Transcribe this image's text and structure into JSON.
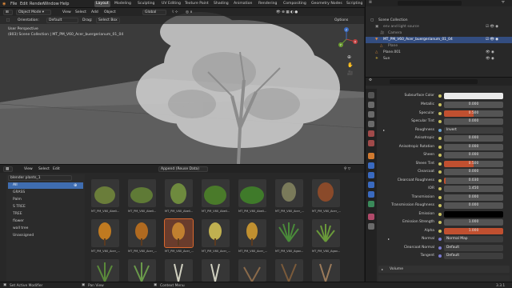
{
  "topbar": {
    "menus": [
      "File",
      "Edit",
      "Render",
      "Window",
      "Help"
    ],
    "workspaces": [
      "Layout",
      "Modeling",
      "Sculpting",
      "UV Editing",
      "Texture Paint",
      "Shading",
      "Animation",
      "Rendering",
      "Compositing",
      "Geometry Nodes",
      "Scripting"
    ],
    "active_workspace": "Layout",
    "scene": "Scene",
    "view_layer": "ViewLayer"
  },
  "viewport": {
    "mode": "Object Mode",
    "menus": [
      "View",
      "Select",
      "Add",
      "Object"
    ],
    "transform": "Global",
    "orientation_label": "Orientation:",
    "orientation_value": "Default",
    "drag_label": "Drag:",
    "drag_value": "Select Box",
    "options": "Options",
    "overlay_line1": "User Perspective",
    "overlay_line2": "(803) Scene Collection | MT_PM_V60_Acer_buergerianum_01_04",
    "gizmo_axes": [
      "X",
      "Y",
      "Z"
    ]
  },
  "asset_browser": {
    "menus": [
      "View",
      "Select",
      "Edit"
    ],
    "library": "blender plants_1",
    "import_type": "Append (Reuse Data)",
    "categories": [
      "All",
      "GRASS",
      "Palm",
      "S TREE",
      "TREE",
      "flower",
      "wall tree",
      "Unassigned"
    ],
    "active_category": "All",
    "tiles_row1": [
      "MT_PM_V60_Abeli...",
      "MT_PM_V60_Abeli...",
      "MT_PM_V60_Abeli...",
      "MT_PM_V60_Abeli...",
      "MT_PM_V60_Abeli...",
      "MT_PM_V60_Acer_...",
      "MT_PM_V60_Acer_..."
    ],
    "tiles_row2": [
      "MT_PM_V60_Acer_...",
      "MT_PM_V60_Acer_...",
      "MT_PM_V60_Acer_...",
      "MT_PM_V60_Acer_...",
      "MT_PM_V60_Acer_...",
      "MT_PM_V60_Agav...",
      "MT_PM_V60_Agav..."
    ]
  },
  "outliner": {
    "title": "Scene Collection",
    "rows": [
      "Scene Collection",
      "env and light source",
      "Camera",
      "MT_PM_V60_Acer_buergerianum_01_04",
      "Plane",
      "Plane.001",
      "Sun"
    ],
    "selected_row": "MT_PM_V60_Acer_buergerianum_01_04"
  },
  "properties": {
    "rows": [
      {
        "label": "Subsurface Color",
        "value": ""
      },
      {
        "label": "Metallic",
        "value": "0.000"
      },
      {
        "label": "Specular",
        "value": "0.500"
      },
      {
        "label": "Specular Tint",
        "value": "0.000"
      },
      {
        "label": "Roughness",
        "value": "Invert"
      },
      {
        "label": "Anisotropic",
        "value": "0.000"
      },
      {
        "label": "Anisotropic Rotation",
        "value": "0.000"
      },
      {
        "label": "Sheen",
        "value": "0.000"
      },
      {
        "label": "Sheen Tint",
        "value": "0.500"
      },
      {
        "label": "Clearcoat",
        "value": "0.000"
      },
      {
        "label": "Clearcoat Roughness",
        "value": "0.030"
      },
      {
        "label": "IOR",
        "value": "1.450"
      },
      {
        "label": "Transmission",
        "value": "0.000"
      },
      {
        "label": "Transmission Roughness",
        "value": "0.000"
      },
      {
        "label": "Emission",
        "value": ""
      },
      {
        "label": "Emission Strength",
        "value": "1.000"
      },
      {
        "label": "Alpha",
        "value": "1.000"
      },
      {
        "label": "Normal",
        "value": "Normal Map"
      },
      {
        "label": "Clearcoat Normal",
        "value": "Default"
      },
      {
        "label": "Tangent",
        "value": "Default"
      }
    ],
    "section": "Volume"
  },
  "statusbar": {
    "items": [
      "Set Active Modifier",
      "Pan View",
      "Context Menu"
    ],
    "version": "3.3.1"
  },
  "colors": {
    "accent": "#3f6db0",
    "selected_orange": "#d9682f",
    "bg": "#1d1d1d"
  }
}
